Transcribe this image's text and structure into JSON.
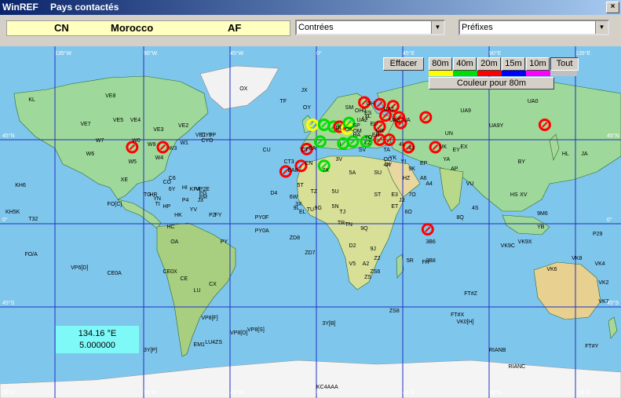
{
  "window": {
    "app": "WinREF",
    "title": "Pays contactés",
    "close": "×"
  },
  "country": {
    "prefix": "CN",
    "name": "Morocco",
    "continent": "AF"
  },
  "selectors": {
    "regions": "Contrées",
    "prefixes": "Préfixes"
  },
  "controls": {
    "clear": "Effacer",
    "bands": [
      "80m",
      "40m",
      "20m",
      "15m",
      "10m",
      "Tout"
    ],
    "band_colors": [
      "#ffff00",
      "#00dd00",
      "#ff0000",
      "#0000ff",
      "#ff00ff",
      "#c0c0c0"
    ],
    "color_hint": "Couleur pour 80m"
  },
  "coords": {
    "lon": "134.16 °E",
    "lat": "5.000000"
  },
  "grid": {
    "top_lon": [
      "135°W",
      "90°W",
      "45°W",
      "0°",
      "45°E",
      "90°E",
      "135°E"
    ],
    "bottom_lon": [
      "90°S",
      "90°W",
      "45°W",
      "0",
      "45°E",
      "90°E",
      "135°E"
    ],
    "lat_left": [
      "45°N",
      "0°",
      "45°S"
    ],
    "lat_right": [
      "45°N",
      "0°",
      "45°S"
    ]
  },
  "prefixes": [
    "KL",
    "VE8",
    "OX",
    "JX",
    "TF",
    "OY",
    "VE7",
    "VE5",
    "VE4",
    "VE3",
    "VE2",
    "VE1",
    "W7",
    "W6",
    "W5",
    "W4",
    "W3",
    "W0",
    "W9",
    "W1",
    "FP",
    "CU",
    "CT3",
    "EA8",
    "CN",
    "D4",
    "C6",
    "CO",
    "HI",
    "KP4",
    "KH6",
    "XE",
    "T32",
    "KH5K",
    "FO[C]",
    "YN",
    "HR",
    "HP",
    "HK",
    "YV",
    "P4",
    "J3",
    "PZ",
    "FY",
    "PY",
    "CE",
    "CX",
    "LU",
    "ZS",
    "V5",
    "ZS8",
    "3B6",
    "3B8",
    "FR",
    "5R",
    "9J",
    "Z2",
    "A2",
    "D2",
    "9Q",
    "TN",
    "TR",
    "TJ",
    "5N",
    "9G",
    "TU",
    "3X",
    "9L",
    "EL",
    "6W",
    "TZ",
    "5U",
    "5T",
    "ST",
    "SU",
    "5A",
    "7X",
    "3V",
    "HZ",
    "YI",
    "EP",
    "EX",
    "UN",
    "UA9",
    "UA0",
    "UA9Y",
    "BY",
    "JA",
    "HL",
    "UK",
    "YA",
    "AP",
    "VU",
    "4S",
    "8Q",
    "XV",
    "HS",
    "9M6",
    "YB",
    "VK6",
    "VK8",
    "VK4",
    "VK2",
    "VK7",
    "ZL",
    "P29",
    "H44",
    "YJ",
    "FK",
    "FO/A",
    "3D2",
    "VP6[D]",
    "CE0A",
    "CE0X",
    "PY0A",
    "PY0F",
    "ZD8",
    "ZD7",
    "VP8[F]",
    "VP8[O]",
    "3Y[B]",
    "VP8[S]",
    "KC4AAA",
    "FT#X",
    "VK0[H]",
    "FT#Z",
    "FT#Y",
    "RIANB",
    "RIANC",
    "3Y[P]",
    "EM1",
    "LU4ZS",
    "VK0[M]",
    "VK9N",
    "VK9L",
    "VK9C",
    "VK9X",
    "CY9",
    "CYO",
    "ZS6",
    "VP2E",
    "FG",
    "FM",
    "6Y",
    "TG",
    "TI",
    "LU",
    "OA",
    "HC",
    "CT",
    "EA",
    "I",
    "DL",
    "SM",
    "OH",
    "OH0",
    "UA1",
    "UA3",
    "UA",
    "UA2",
    "LY",
    "ES",
    "YL",
    "SP",
    "OK",
    "OM",
    "HA",
    "YO",
    "LZ",
    "SV",
    "TA",
    "4X",
    "JY",
    "OD",
    "YK",
    "UR",
    "EU",
    "ER",
    "4L",
    "4J",
    "UN",
    "UK",
    "EY",
    "EX",
    "9K",
    "A4",
    "A6",
    "7O",
    "ET",
    "6O",
    "J2",
    "E3"
  ],
  "contacts": [
    {
      "lon": -96,
      "lat": 41,
      "band": "20m"
    },
    {
      "lon": -80,
      "lat": 41,
      "band": "20m"
    },
    {
      "lon": -16,
      "lat": 28,
      "band": "20m"
    },
    {
      "lon": -8,
      "lat": 31,
      "band": "20m"
    },
    {
      "lon": -5,
      "lat": 40,
      "band": "20m"
    },
    {
      "lon": 2,
      "lat": 44,
      "band": "40m"
    },
    {
      "lon": 4,
      "lat": 31,
      "band": "40m"
    },
    {
      "lon": -2,
      "lat": 53,
      "band": "80m"
    },
    {
      "lon": 4,
      "lat": 53,
      "band": "40m"
    },
    {
      "lon": 9,
      "lat": 52,
      "band": "40m"
    },
    {
      "lon": 12,
      "lat": 52,
      "band": "20m"
    },
    {
      "lon": 16,
      "lat": 51,
      "band": "80m"
    },
    {
      "lon": 17,
      "lat": 54,
      "band": "40m"
    },
    {
      "lon": 25,
      "lat": 65,
      "band": "20m"
    },
    {
      "lon": 33,
      "lat": 64,
      "band": "20m"
    },
    {
      "lon": 40,
      "lat": 63,
      "band": "20m"
    },
    {
      "lon": 36,
      "lat": 58,
      "band": "20m"
    },
    {
      "lon": 33,
      "lat": 52,
      "band": "20m"
    },
    {
      "lon": 43,
      "lat": 57,
      "band": "20m"
    },
    {
      "lon": 57,
      "lat": 57,
      "band": "20m"
    },
    {
      "lon": 44,
      "lat": 54,
      "band": "20m"
    },
    {
      "lon": 38,
      "lat": 45,
      "band": "20m"
    },
    {
      "lon": 33,
      "lat": 45,
      "band": "20m"
    },
    {
      "lon": 26,
      "lat": 44,
      "band": "40m"
    },
    {
      "lon": 14,
      "lat": 43,
      "band": "40m"
    },
    {
      "lon": 19,
      "lat": 44,
      "band": "40m"
    },
    {
      "lon": 48,
      "lat": 41,
      "band": "20m"
    },
    {
      "lon": 62,
      "lat": 41,
      "band": "20m"
    },
    {
      "lon": 119,
      "lat": 53,
      "band": "20m"
    },
    {
      "lon": 58,
      "lat": -3,
      "band": "20m"
    }
  ]
}
